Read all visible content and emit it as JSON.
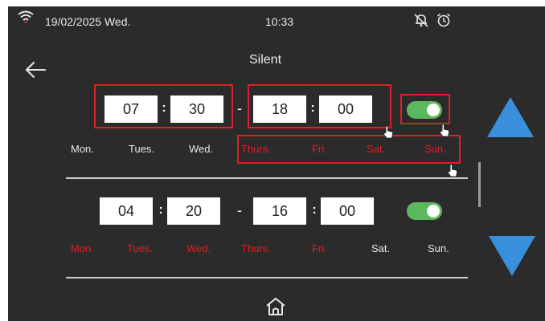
{
  "status_bar": {
    "date": "19/02/2025 Wed.",
    "time": "10:33",
    "wifi_icon": "wifi-icon",
    "bell_icon": "bell-muted-icon",
    "alarm_icon": "alarm-clock-icon"
  },
  "header": {
    "title": "Silent",
    "back_icon": "back-arrow-icon"
  },
  "schedules": [
    {
      "start_hour": "07",
      "start_minute": "30",
      "end_hour": "18",
      "end_minute": "00",
      "colon": ":",
      "dash": "-",
      "enabled": true,
      "days": [
        {
          "label": "Mon.",
          "selected": false
        },
        {
          "label": "Tues.",
          "selected": false
        },
        {
          "label": "Wed.",
          "selected": false
        },
        {
          "label": "Thurs.",
          "selected": true
        },
        {
          "label": "Fri.",
          "selected": true
        },
        {
          "label": "Sat.",
          "selected": true
        },
        {
          "label": "Sun.",
          "selected": true
        }
      ]
    },
    {
      "start_hour": "04",
      "start_minute": "20",
      "end_hour": "16",
      "end_minute": "00",
      "colon": ":",
      "dash": "-",
      "enabled": true,
      "days": [
        {
          "label": "Mon.",
          "selected": true
        },
        {
          "label": "Tues.",
          "selected": true
        },
        {
          "label": "Wed.",
          "selected": true
        },
        {
          "label": "Thurs.",
          "selected": true
        },
        {
          "label": "Fri.",
          "selected": true
        },
        {
          "label": "Sat.",
          "selected": false
        },
        {
          "label": "Sun.",
          "selected": false
        }
      ]
    }
  ],
  "colors": {
    "background": "#2b2b2b",
    "selected_day": "#e31e24",
    "toggle_on": "#5cb85c",
    "arrow": "#3a8fdc",
    "highlight": "#e01f26"
  },
  "footer": {
    "home_icon": "home-icon"
  }
}
